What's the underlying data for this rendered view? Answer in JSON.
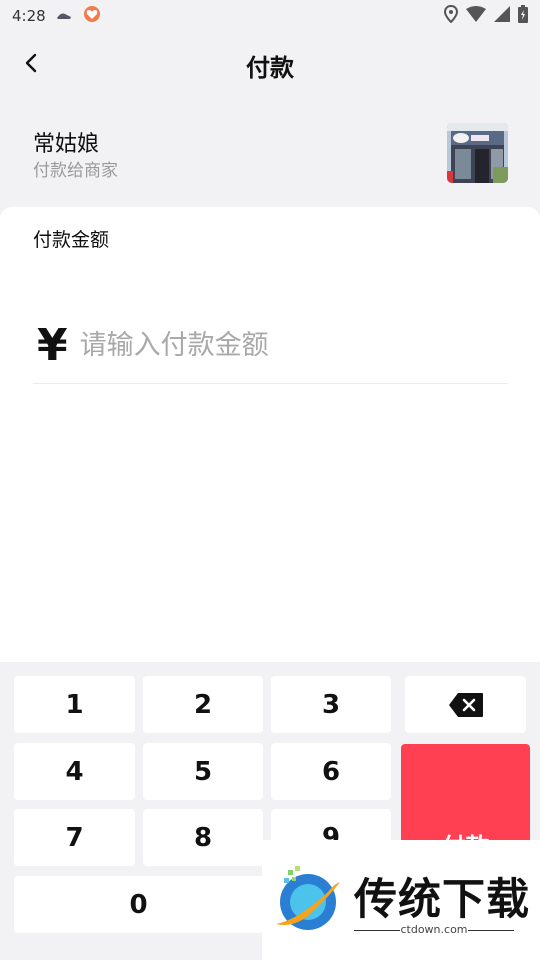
{
  "status": {
    "time": "4:28"
  },
  "nav": {
    "title": "付款"
  },
  "merchant": {
    "name": "常姑娘",
    "subtitle": "付款给商家"
  },
  "payment": {
    "label": "付款金额",
    "currency": "¥",
    "placeholder": "请输入付款金额"
  },
  "keypad": {
    "keys": [
      "1",
      "2",
      "3",
      "4",
      "5",
      "6",
      "7",
      "8",
      "9",
      "0"
    ],
    "pay_label": "付款"
  },
  "watermark": {
    "title": "传统下载",
    "url": "ctdown.com"
  },
  "colors": {
    "accent": "#fe4052",
    "background": "#f2f2f4"
  },
  "icons": [
    "back-arrow-icon",
    "location-icon",
    "wifi-icon",
    "signal-icon",
    "battery-icon",
    "backspace-icon"
  ]
}
